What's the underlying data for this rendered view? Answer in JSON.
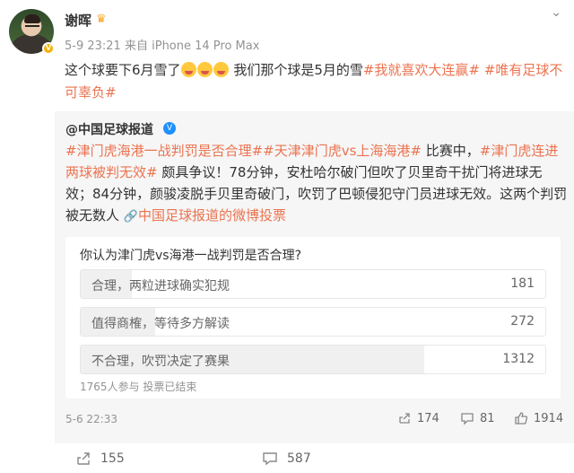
{
  "author": {
    "name": "谢晖"
  },
  "meta": {
    "time": "5-9 23:21",
    "source": "来自 iPhone 14 Pro Max"
  },
  "post": {
    "text_1": "这个球要下6月雪了",
    "text_2": " 我们那个球是5月的雪",
    "tag_1": "#我就喜欢大连赢#",
    "tag_2": " #唯有足球不可辜负#"
  },
  "repost": {
    "author": "@中国足球报道",
    "tag_1": "#津门虎海港一战判罚是否合理#",
    "tag_2": "#天津津门虎vs上海海港#",
    "text_1": "比赛中，",
    "tag_3": "#津门虎连进两球被判无效#",
    "text_2": "颇具争议！78分钟，安杜哈尔破门但吹了贝里奇干扰门将进球无效；84分钟，颜骏凌脱手贝里奇破门，吹罚了巴顿侵犯守门员进球无效。这两个判罚被无数人",
    "link": "中国足球报道的微博投票",
    "date": "5-6 22:33",
    "reposts": "174",
    "comments": "81",
    "likes": "1914"
  },
  "poll": {
    "question": "你认为津门虎vs海港一战判罚是否合理?",
    "options": [
      {
        "label": "合理，两粒进球确实犯规",
        "count": "181",
        "fraction": 0.11
      },
      {
        "label": "值得商榷，等待多方解读",
        "count": "272",
        "fraction": 0.16
      },
      {
        "label": "不合理，吹罚决定了赛果",
        "count": "1312",
        "fraction": 0.74
      }
    ],
    "footer": "1765人参与 投票已结束"
  },
  "actions": {
    "reposts": "155",
    "comments": "587"
  },
  "colors": {
    "accent": "#eb7350",
    "muted": "#939393",
    "verified_blue": "#1e90ff",
    "verified_gold": "#f4b000"
  }
}
